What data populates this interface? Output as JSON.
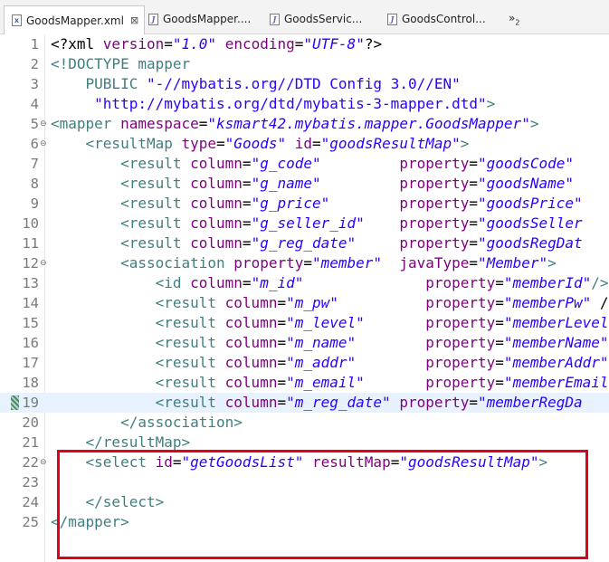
{
  "tabs": [
    {
      "label": "GoodsMapper.xml",
      "icon": "xml-file-icon",
      "active": true,
      "close": "⊠"
    },
    {
      "label": "GoodsMapper....",
      "icon": "java-file-icon",
      "active": false
    },
    {
      "label": "GoodsServic...",
      "icon": "java-file-icon",
      "active": false
    },
    {
      "label": "GoodsControl...",
      "icon": "java-file-icon",
      "active": false
    }
  ],
  "overflow_label": "»",
  "overflow_count": "2",
  "current_line": 19,
  "highlight_lines": [
    22,
    24
  ],
  "lines": [
    {
      "n": "1",
      "fold": "",
      "segs": [
        [
          "t-plain",
          "<?xml "
        ],
        [
          "t-attr",
          "version"
        ],
        [
          "t-plain",
          "="
        ],
        [
          "t-val",
          "\"1.0\""
        ],
        [
          "t-plain",
          " "
        ],
        [
          "t-attr",
          "encoding"
        ],
        [
          "t-plain",
          "="
        ],
        [
          "t-val",
          "\"UTF-8\""
        ],
        [
          "t-plain",
          "?>"
        ]
      ]
    },
    {
      "n": "2",
      "fold": "",
      "segs": [
        [
          "t-tag",
          "<!DOCTYPE mapper"
        ]
      ]
    },
    {
      "n": "3",
      "fold": "",
      "segs": [
        [
          "t-doc",
          "    PUBLIC "
        ],
        [
          "t-str",
          "\"-//mybatis.org//DTD Config 3.0//EN\""
        ]
      ]
    },
    {
      "n": "4",
      "fold": "",
      "segs": [
        [
          "t-str",
          "     \"http://mybatis.org/dtd/mybatis-3-mapper.dtd\""
        ],
        [
          "t-doc",
          ">"
        ]
      ]
    },
    {
      "n": "5",
      "fold": "⊖",
      "segs": [
        [
          "t-tag",
          "<mapper "
        ],
        [
          "t-attr",
          "namespace"
        ],
        [
          "t-plain",
          "="
        ],
        [
          "t-val",
          "\"ksmart42.mybatis.mapper.GoodsMapper\""
        ],
        [
          "t-tag",
          ">"
        ]
      ]
    },
    {
      "n": "6",
      "fold": "⊖",
      "segs": [
        [
          "t-tag",
          "    <resultMap "
        ],
        [
          "t-attr",
          "type"
        ],
        [
          "t-plain",
          "="
        ],
        [
          "t-val",
          "\"Goods\""
        ],
        [
          "t-plain",
          " "
        ],
        [
          "t-attr",
          "id"
        ],
        [
          "t-plain",
          "="
        ],
        [
          "t-val",
          "\"goodsResultMap\""
        ],
        [
          "t-tag",
          ">"
        ]
      ]
    },
    {
      "n": "7",
      "fold": "",
      "segs": [
        [
          "t-tag",
          "        <result "
        ],
        [
          "t-attr",
          "column"
        ],
        [
          "t-plain",
          "="
        ],
        [
          "t-val",
          "\"g_code\""
        ],
        [
          "t-plain",
          "         "
        ],
        [
          "t-attr",
          "property"
        ],
        [
          "t-plain",
          "="
        ],
        [
          "t-val",
          "\"goodsCode\""
        ]
      ]
    },
    {
      "n": "8",
      "fold": "",
      "segs": [
        [
          "t-tag",
          "        <result "
        ],
        [
          "t-attr",
          "column"
        ],
        [
          "t-plain",
          "="
        ],
        [
          "t-val",
          "\"g_name\""
        ],
        [
          "t-plain",
          "         "
        ],
        [
          "t-attr",
          "property"
        ],
        [
          "t-plain",
          "="
        ],
        [
          "t-val",
          "\"goodsName\""
        ]
      ]
    },
    {
      "n": "9",
      "fold": "",
      "segs": [
        [
          "t-tag",
          "        <result "
        ],
        [
          "t-attr",
          "column"
        ],
        [
          "t-plain",
          "="
        ],
        [
          "t-val",
          "\"g_price\""
        ],
        [
          "t-plain",
          "        "
        ],
        [
          "t-attr",
          "property"
        ],
        [
          "t-plain",
          "="
        ],
        [
          "t-val",
          "\"goodsPrice\""
        ]
      ]
    },
    {
      "n": "10",
      "fold": "",
      "segs": [
        [
          "t-tag",
          "        <result "
        ],
        [
          "t-attr",
          "column"
        ],
        [
          "t-plain",
          "="
        ],
        [
          "t-val",
          "\"g_seller_id\""
        ],
        [
          "t-plain",
          "    "
        ],
        [
          "t-attr",
          "property"
        ],
        [
          "t-plain",
          "="
        ],
        [
          "t-val",
          "\"goodsSeller"
        ]
      ]
    },
    {
      "n": "11",
      "fold": "",
      "segs": [
        [
          "t-tag",
          "        <result "
        ],
        [
          "t-attr",
          "column"
        ],
        [
          "t-plain",
          "="
        ],
        [
          "t-val",
          "\"g_reg_date\""
        ],
        [
          "t-plain",
          "     "
        ],
        [
          "t-attr",
          "property"
        ],
        [
          "t-plain",
          "="
        ],
        [
          "t-val",
          "\"goodsRegDat"
        ]
      ]
    },
    {
      "n": "12",
      "fold": "⊖",
      "segs": [
        [
          "t-tag",
          "        <association "
        ],
        [
          "t-attr",
          "property"
        ],
        [
          "t-plain",
          "="
        ],
        [
          "t-val",
          "\"member\""
        ],
        [
          "t-plain",
          "  "
        ],
        [
          "t-attr",
          "javaType"
        ],
        [
          "t-plain",
          "="
        ],
        [
          "t-val",
          "\"Member\""
        ],
        [
          "t-tag",
          ">"
        ]
      ]
    },
    {
      "n": "13",
      "fold": "",
      "segs": [
        [
          "t-tag",
          "            <id "
        ],
        [
          "t-attr",
          "column"
        ],
        [
          "t-plain",
          "="
        ],
        [
          "t-val",
          "\"m_id\""
        ],
        [
          "t-plain",
          "              "
        ],
        [
          "t-attr",
          "property"
        ],
        [
          "t-plain",
          "="
        ],
        [
          "t-val",
          "\"memberId\""
        ],
        [
          "t-tag",
          "/>"
        ]
      ]
    },
    {
      "n": "14",
      "fold": "",
      "segs": [
        [
          "t-tag",
          "            <result "
        ],
        [
          "t-attr",
          "column"
        ],
        [
          "t-plain",
          "="
        ],
        [
          "t-val",
          "\"m_pw\""
        ],
        [
          "t-plain",
          "          "
        ],
        [
          "t-attr",
          "property"
        ],
        [
          "t-plain",
          "="
        ],
        [
          "t-val",
          "\"memberPw\""
        ],
        [
          "t-plain",
          " /"
        ]
      ]
    },
    {
      "n": "15",
      "fold": "",
      "segs": [
        [
          "t-tag",
          "            <result "
        ],
        [
          "t-attr",
          "column"
        ],
        [
          "t-plain",
          "="
        ],
        [
          "t-val",
          "\"m_level\""
        ],
        [
          "t-plain",
          "       "
        ],
        [
          "t-attr",
          "property"
        ],
        [
          "t-plain",
          "="
        ],
        [
          "t-val",
          "\"memberLevel"
        ]
      ]
    },
    {
      "n": "16",
      "fold": "",
      "segs": [
        [
          "t-tag",
          "            <result "
        ],
        [
          "t-attr",
          "column"
        ],
        [
          "t-plain",
          "="
        ],
        [
          "t-val",
          "\"m_name\""
        ],
        [
          "t-plain",
          "        "
        ],
        [
          "t-attr",
          "property"
        ],
        [
          "t-plain",
          "="
        ],
        [
          "t-val",
          "\"memberName\""
        ]
      ]
    },
    {
      "n": "17",
      "fold": "",
      "segs": [
        [
          "t-tag",
          "            <result "
        ],
        [
          "t-attr",
          "column"
        ],
        [
          "t-plain",
          "="
        ],
        [
          "t-val",
          "\"m_addr\""
        ],
        [
          "t-plain",
          "        "
        ],
        [
          "t-attr",
          "property"
        ],
        [
          "t-plain",
          "="
        ],
        [
          "t-val",
          "\"memberAddr\""
        ]
      ]
    },
    {
      "n": "18",
      "fold": "",
      "segs": [
        [
          "t-tag",
          "            <result "
        ],
        [
          "t-attr",
          "column"
        ],
        [
          "t-plain",
          "="
        ],
        [
          "t-val",
          "\"m_email\""
        ],
        [
          "t-plain",
          "       "
        ],
        [
          "t-attr",
          "property"
        ],
        [
          "t-plain",
          "="
        ],
        [
          "t-val",
          "\"memberEmail"
        ]
      ]
    },
    {
      "n": "19",
      "fold": "",
      "segs": [
        [
          "t-tag",
          "            <result "
        ],
        [
          "t-attr",
          "column"
        ],
        [
          "t-plain",
          "="
        ],
        [
          "t-val",
          "\"m_reg_date\""
        ],
        [
          "t-plain",
          " "
        ],
        [
          "t-attr",
          "property"
        ],
        [
          "t-plain",
          "="
        ],
        [
          "t-val",
          "\"memberRegDa"
        ]
      ]
    },
    {
      "n": "20",
      "fold": "",
      "segs": [
        [
          "t-tag",
          "        </association>"
        ]
      ]
    },
    {
      "n": "21",
      "fold": "",
      "segs": [
        [
          "t-tag",
          "    </resultMap>"
        ]
      ]
    },
    {
      "n": "22",
      "fold": "⊖",
      "segs": [
        [
          "t-tag",
          "    <select "
        ],
        [
          "t-attr",
          "id"
        ],
        [
          "t-plain",
          "="
        ],
        [
          "t-val",
          "\"getGoodsList\""
        ],
        [
          "t-plain",
          " "
        ],
        [
          "t-attr",
          "resultMap"
        ],
        [
          "t-plain",
          "="
        ],
        [
          "t-val",
          "\"goodsResultMap\""
        ],
        [
          "t-tag",
          ">"
        ]
      ]
    },
    {
      "n": "23",
      "fold": "",
      "segs": [
        [
          "t-plain",
          "        "
        ]
      ]
    },
    {
      "n": "24",
      "fold": "",
      "segs": [
        [
          "t-tag",
          "    </select>"
        ]
      ]
    },
    {
      "n": "25",
      "fold": "",
      "segs": [
        [
          "t-tag",
          "</mapper>"
        ]
      ]
    }
  ]
}
